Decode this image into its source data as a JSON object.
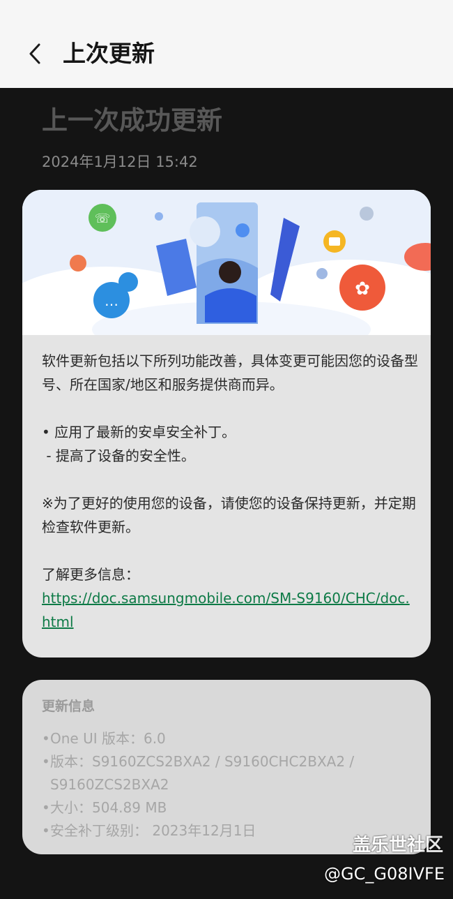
{
  "header": {
    "back_icon": "chevron-left-icon",
    "title": "上次更新"
  },
  "main": {
    "title": "上一次成功更新",
    "date": "2024年1月12日 15:42"
  },
  "release_notes": {
    "banner_icon": "samsung-update-illustration",
    "intro": "软件更新包括以下所列功能改善，具体变更可能因您的设备型号、所在国家/地区和服务提供商而异。",
    "bullet": "• 应用了最新的安卓安全补丁。",
    "sub_bullet": " - 提高了设备的安全性。",
    "note": "※为了更好的使用您的设备，请使您的设备保持更新，并定期检查软件更新。",
    "more_info_label": "了解更多信息：",
    "link": "https://doc.samsungmobile.com/SM-S9160/CHC/doc.html"
  },
  "update_info": {
    "title": "更新信息",
    "items": [
      {
        "bullet": "•",
        "text": "One UI 版本：6.0"
      },
      {
        "bullet": "•",
        "text": "版本：S9160ZCS2BXA2 / S9160CHC2BXA2 / S9160ZCS2BXA2"
      },
      {
        "bullet": "•",
        "text": "大小：504.89 MB"
      },
      {
        "bullet": "•",
        "text": "安全补丁级别： 2023年12月1日"
      }
    ]
  },
  "watermark": {
    "name": "盖乐世社区",
    "handle": "@GC_G08IVFE"
  },
  "colors": {
    "background": "#141414",
    "header": "#f6f6f6",
    "card": "#e4e4e4",
    "link": "#0d7a46"
  }
}
